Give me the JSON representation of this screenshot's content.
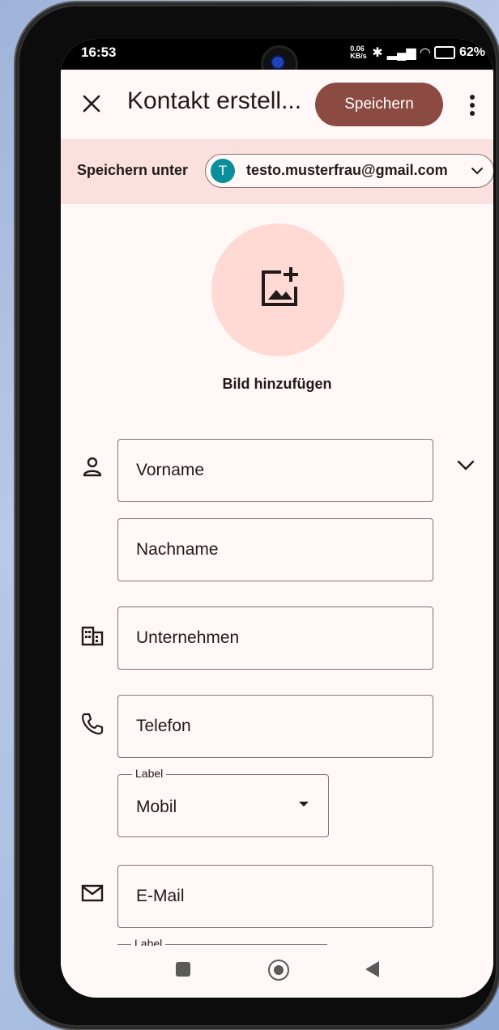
{
  "status": {
    "time": "16:53",
    "speed": "0.06 KB/s",
    "battery": "62%"
  },
  "appbar": {
    "title": "Kontakt erstell...",
    "save_label": "Speichern"
  },
  "account": {
    "save_under_label": "Speichern unter",
    "avatar_letter": "T",
    "email": "testo.musterfrau@gmail.com"
  },
  "photo": {
    "label": "Bild hinzufügen"
  },
  "form": {
    "first_name": "Vorname",
    "last_name": "Nachname",
    "company": "Unternehmen",
    "phone": "Telefon",
    "phone_label_caption": "Label",
    "phone_label_value": "Mobil",
    "email": "E-Mail",
    "email_label_caption": "Label"
  },
  "colors": {
    "accent": "#8b4a42",
    "avatar": "#0c8f9c",
    "banner": "#fae0df",
    "photo_circle": "#ffdad5"
  }
}
